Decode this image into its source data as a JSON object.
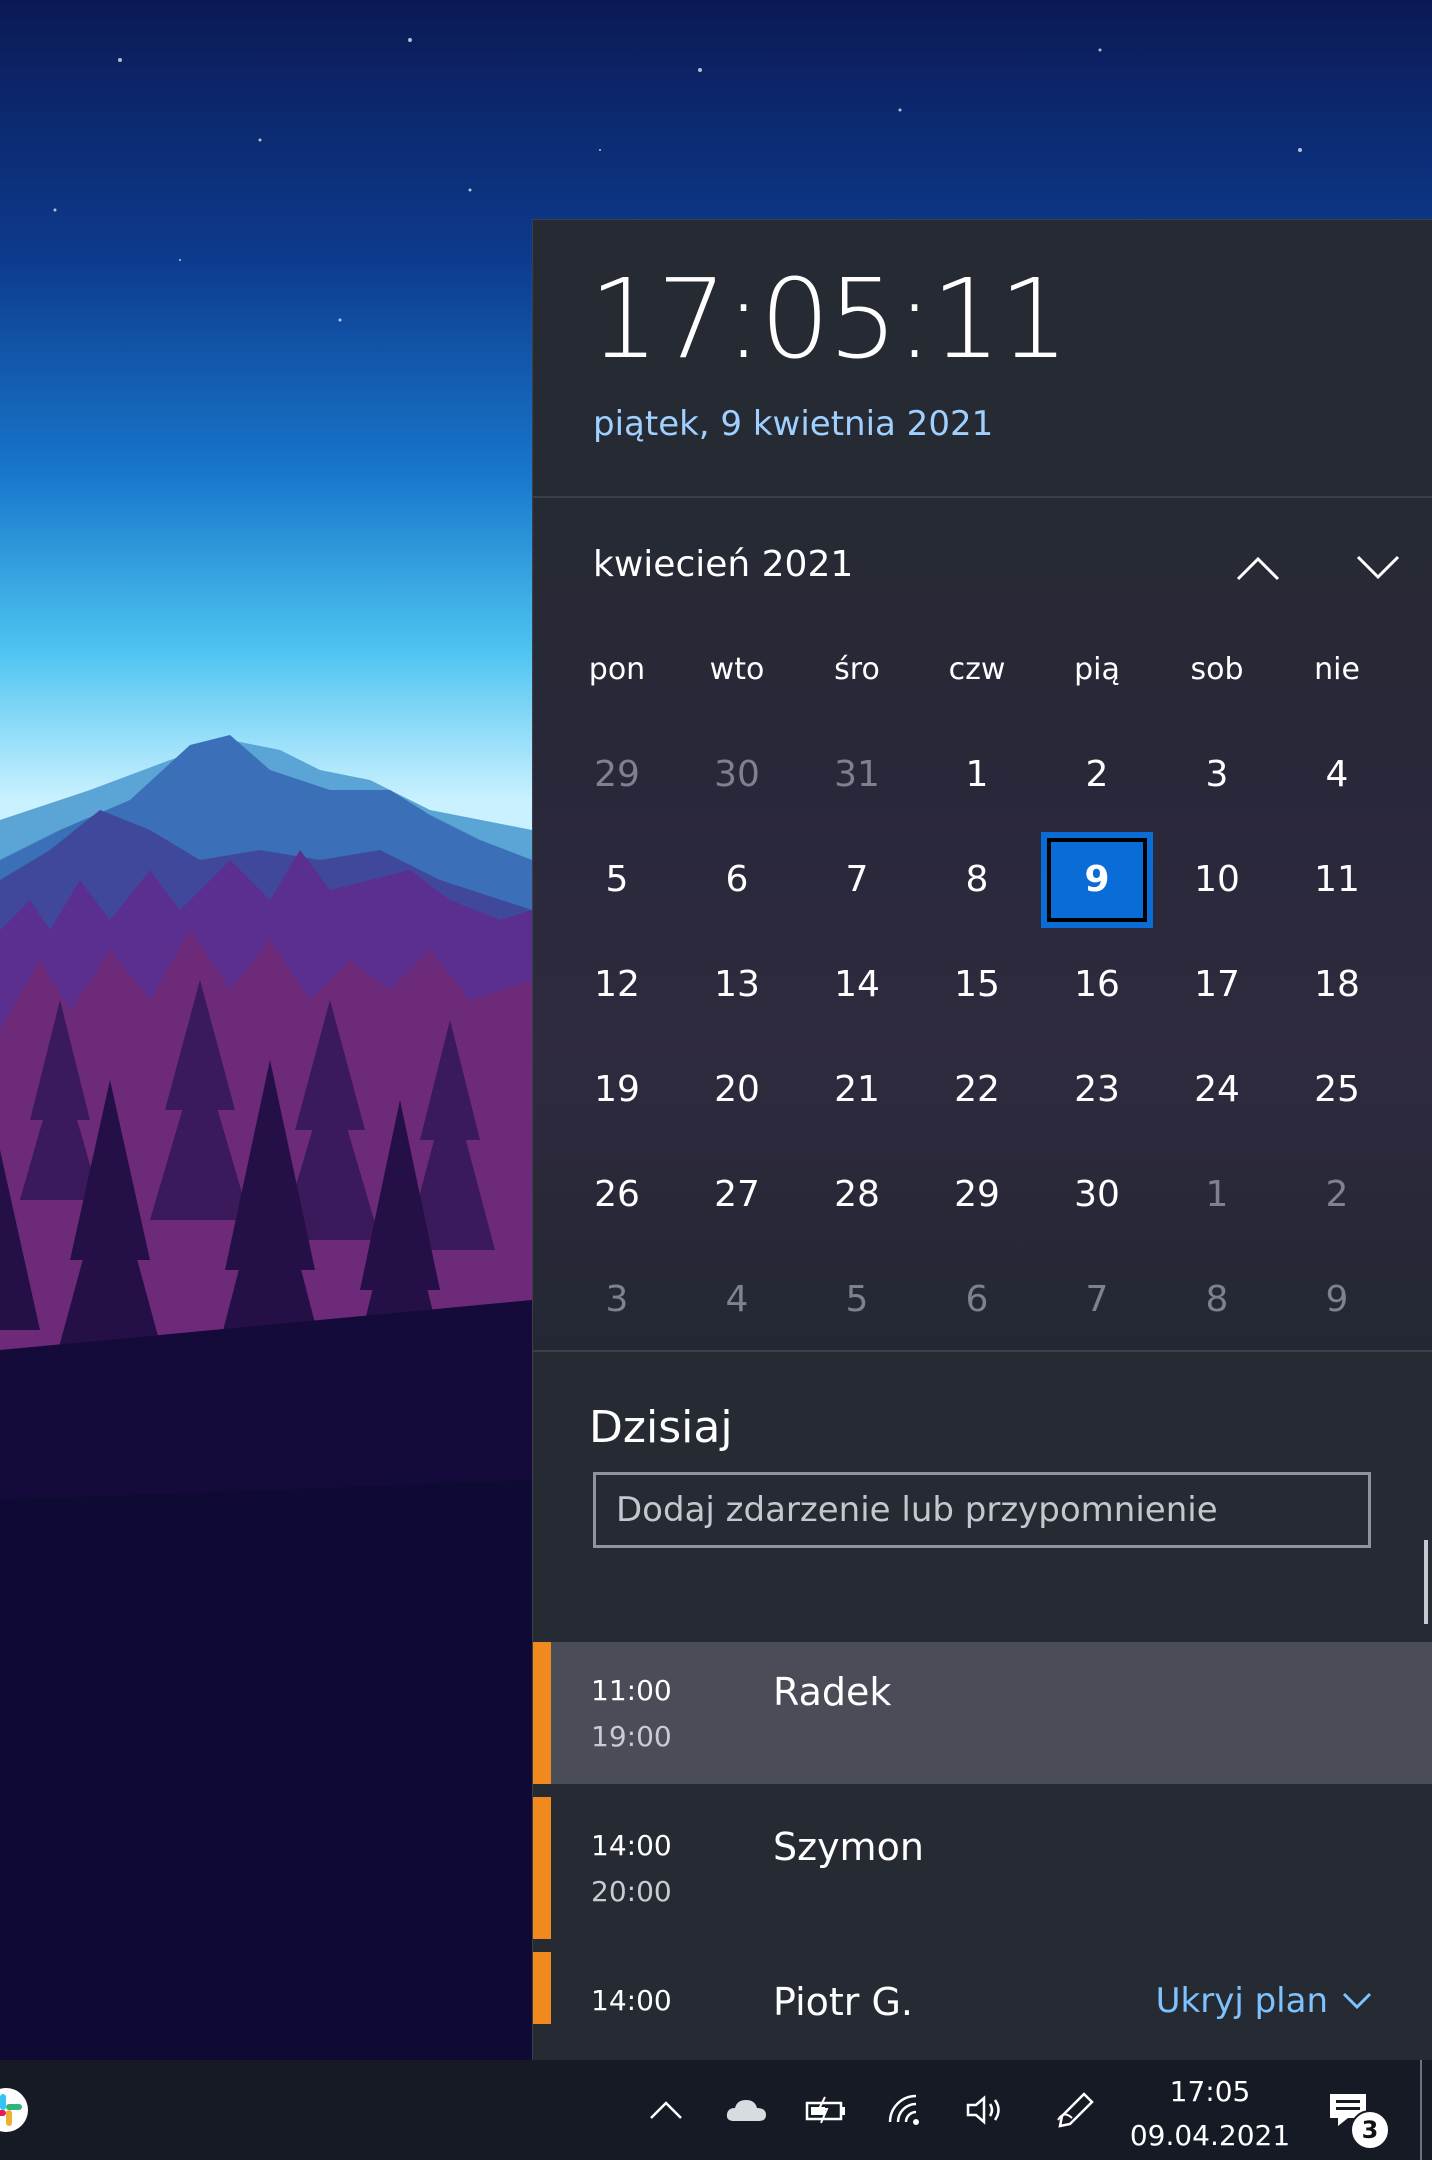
{
  "flyout": {
    "time": "17:05:11",
    "date": "piątek, 9 kwietnia 2021"
  },
  "calendar": {
    "month": "kwiecień 2021",
    "weekdays": [
      "pon",
      "wto",
      "śro",
      "czw",
      "pią",
      "sob",
      "nie"
    ],
    "days": [
      {
        "d": "29",
        "muted": true
      },
      {
        "d": "30",
        "muted": true
      },
      {
        "d": "31",
        "muted": true
      },
      {
        "d": "1"
      },
      {
        "d": "2"
      },
      {
        "d": "3"
      },
      {
        "d": "4"
      },
      {
        "d": "5"
      },
      {
        "d": "6"
      },
      {
        "d": "7"
      },
      {
        "d": "8"
      },
      {
        "d": "9",
        "today": true
      },
      {
        "d": "10"
      },
      {
        "d": "11"
      },
      {
        "d": "12"
      },
      {
        "d": "13"
      },
      {
        "d": "14"
      },
      {
        "d": "15"
      },
      {
        "d": "16"
      },
      {
        "d": "17"
      },
      {
        "d": "18"
      },
      {
        "d": "19"
      },
      {
        "d": "20"
      },
      {
        "d": "21"
      },
      {
        "d": "22"
      },
      {
        "d": "23"
      },
      {
        "d": "24"
      },
      {
        "d": "25"
      },
      {
        "d": "26"
      },
      {
        "d": "27"
      },
      {
        "d": "28"
      },
      {
        "d": "29"
      },
      {
        "d": "30"
      },
      {
        "d": "1",
        "muted": true
      },
      {
        "d": "2",
        "muted": true
      },
      {
        "d": "3",
        "muted": true
      },
      {
        "d": "4",
        "muted": true
      },
      {
        "d": "5",
        "muted": true
      },
      {
        "d": "6",
        "muted": true
      },
      {
        "d": "7",
        "muted": true
      },
      {
        "d": "8",
        "muted": true
      },
      {
        "d": "9",
        "muted": true
      }
    ],
    "nav_up_icon": "chevron-up-icon",
    "nav_down_icon": "chevron-down-icon"
  },
  "agenda": {
    "title": "Dzisiaj",
    "add_placeholder": "Dodaj zdarzenie lub przypomnienie",
    "events": [
      {
        "start": "11:00",
        "end": "19:00",
        "title": "Radek"
      },
      {
        "start": "14:00",
        "end": "20:00",
        "title": "Szymon"
      },
      {
        "start": "14:00",
        "end": "",
        "title": "Piotr G."
      }
    ],
    "hide_plan": "Ukryj plan",
    "event_color": "#f08a1e"
  },
  "taskbar": {
    "time": "17:05",
    "date": "09.04.2021",
    "notification_count": "3",
    "icons": [
      "slack-icon",
      "chevron-up-icon",
      "onedrive-cloud-icon",
      "battery-charging-icon",
      "wifi-icon",
      "volume-icon",
      "pen-icon",
      "notifications-icon"
    ]
  },
  "colors": {
    "accent": "#0a6cd6",
    "link": "#7ec3ff",
    "flyout_bg": "#262a33",
    "taskbar_bg": "#151a24"
  }
}
